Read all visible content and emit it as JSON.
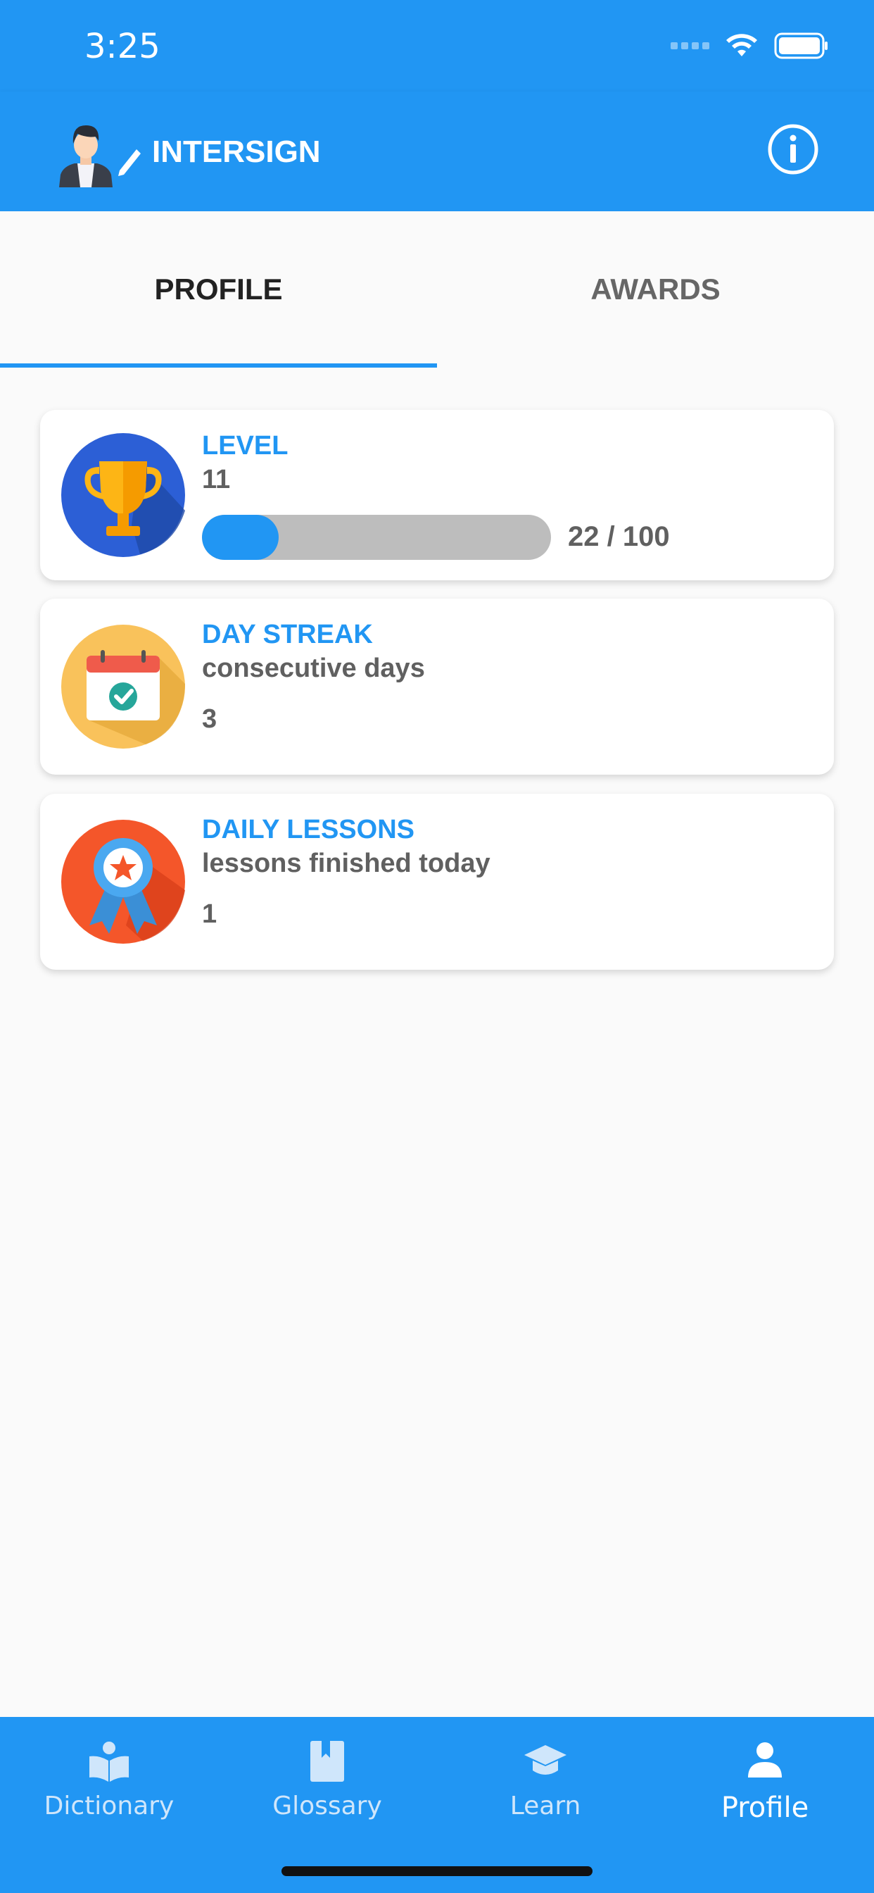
{
  "status_bar": {
    "time": "3:25",
    "wifi_icon": "wifi-icon",
    "battery_icon": "battery-icon"
  },
  "app_bar": {
    "title": "INTERSIGN",
    "logo_icon": "avatar-signer-icon",
    "info_icon": "info-icon"
  },
  "tabs": [
    {
      "label": "PROFILE",
      "selected": true
    },
    {
      "label": "AWARDS",
      "selected": false
    }
  ],
  "cards": {
    "level": {
      "title": "LEVEL",
      "value": "11",
      "progress_text": "22 / 100",
      "progress_fraction": 0.22,
      "icon": "trophy-icon",
      "icon_bg": "#2c5fd6"
    },
    "streak": {
      "title": "DAY STREAK",
      "subtitle": "consecutive days",
      "value": "3",
      "icon": "calendar-check-icon",
      "icon_bg": "#f9c25b"
    },
    "lessons": {
      "title": "DAILY LESSONS",
      "subtitle": "lessons finished today",
      "value": "1",
      "icon": "award-ribbon-icon",
      "icon_bg": "#f4562a"
    }
  },
  "bottom_nav": [
    {
      "label": "Dictionary",
      "icon": "open-book-icon",
      "active": false
    },
    {
      "label": "Glossary",
      "icon": "bookmark-book-icon",
      "active": false
    },
    {
      "label": "Learn",
      "icon": "graduation-cap-icon",
      "active": false
    },
    {
      "label": "Profile",
      "icon": "person-icon",
      "active": true
    }
  ],
  "colors": {
    "primary": "#2196f3",
    "background": "#fafafa",
    "text_gray": "#606060"
  }
}
